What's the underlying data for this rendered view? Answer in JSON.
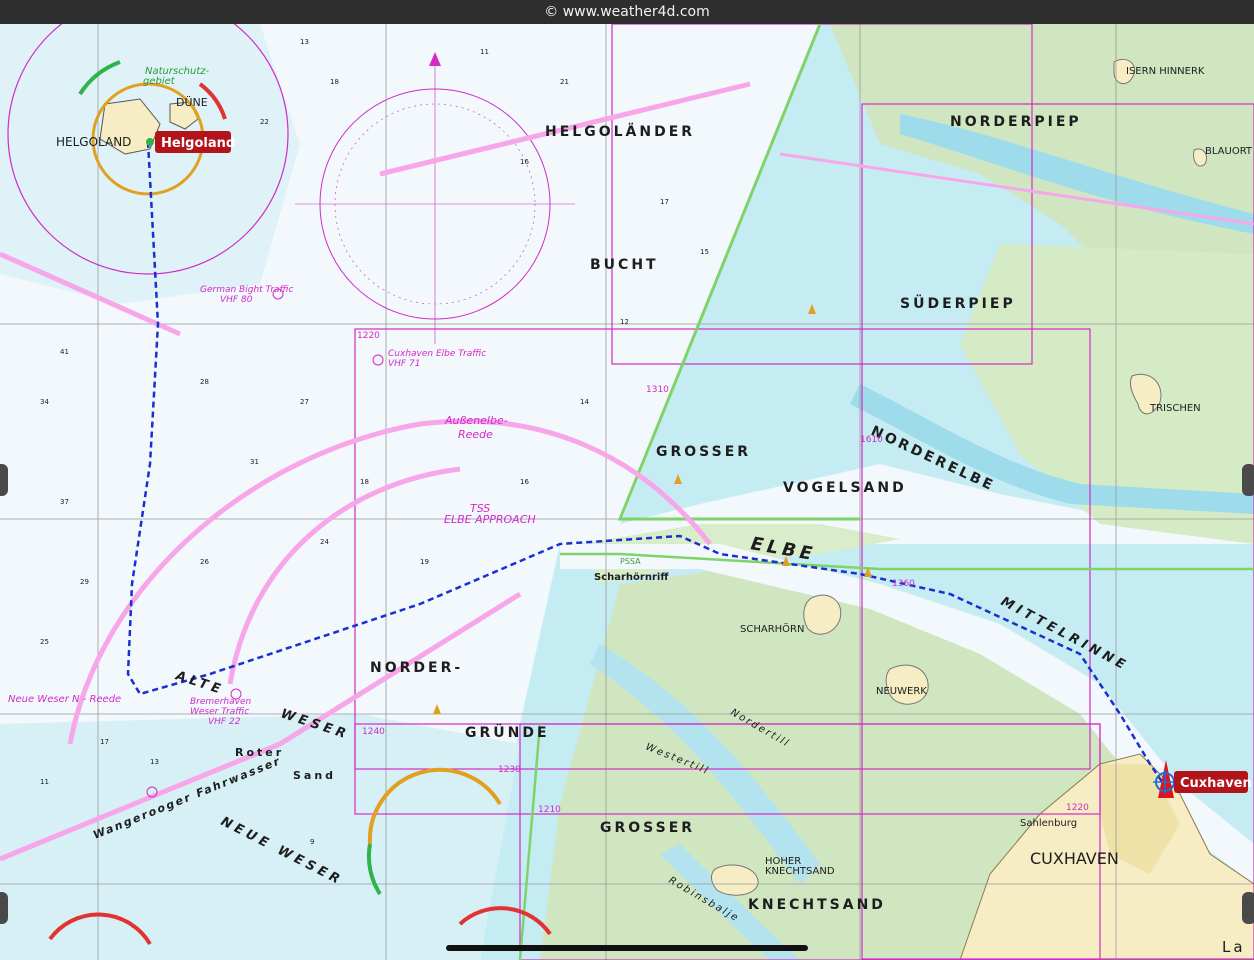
{
  "header": {
    "copyright": "© www.weather4d.com"
  },
  "places": {
    "helgoland": "HELGOLAND",
    "dune": "DÜNE",
    "helgolander": "HELGOLÄNDER",
    "bucht": "BUCHT",
    "norderpiep": "NORDERPIEP",
    "suderpiep": "SÜDERPIEP",
    "isern": "ISERN HINNERK",
    "blauort": "BLAUORT",
    "trischen": "TRISCHEN",
    "norderelbe": "NORDERELBE",
    "grosser1": "GROSSER",
    "vogelsand": "VOGELSAND",
    "elbe": "ELBE",
    "mittelrinne": "MITTELRINNE",
    "scharhornriff": "Scharhörnriff",
    "scharhorn": "SCHARHÖRN",
    "neuwerk": "NEUWERK",
    "norder": "NORDER-",
    "grunde": "GRÜNDE",
    "alte": "ALTE",
    "weser": "WESER",
    "roter": "Roter",
    "sand": "Sand",
    "neueweser": "NEUE WESER",
    "grosser2": "GROSSER",
    "knechtsand": "KNECHTSAND",
    "hoher": "HOHER",
    "knechtsand2": "KNECHTSAND",
    "sahlenburg": "Sahlenburg",
    "cuxhaven_town": "CUXHAVEN",
    "wangerooger": "Wangerooger Fahrwasser",
    "robinsbalje": "Robinsbalje",
    "westertill": "Westertill",
    "nordertill": "Nordertill",
    "naturschutz": "Naturschutz-",
    "gebiet": "gebiet",
    "tss": "TSS",
    "elbe_approach": "ELBE APPROACH",
    "aussenelbe": "Außenelbe-",
    "reede": "Reede",
    "neue_weser_reede": "Neue Weser N - Reede",
    "german_bight1": "German Bight Traffic",
    "vhf80": "VHF 80",
    "cux_elbe": "Cuxhaven Elbe Traffic",
    "vhf71": "VHF 71",
    "bremerhaven": "Bremerhaven",
    "weser_traffic": "Weser Traffic",
    "vhf22": "VHF 22",
    "pssa": "PSSA",
    "land": "La"
  },
  "chart_numbers": [
    "1220",
    "1310",
    "1610",
    "1360",
    "1240",
    "1230",
    "1210",
    "1220"
  ],
  "waypoints": {
    "start": "Helgoland",
    "end": "Cuxhaven"
  },
  "colors": {
    "sea_light": "#eef6fa",
    "shallow": "#bfe8f0",
    "shallow_deep": "#9fdceb",
    "mudflat": "#cfe6c1",
    "land": "#f6edc4",
    "magenta": "#d22bc6",
    "route": "#1a2fd1",
    "badge": "#b3141b",
    "grid": "#9a9a9a"
  }
}
